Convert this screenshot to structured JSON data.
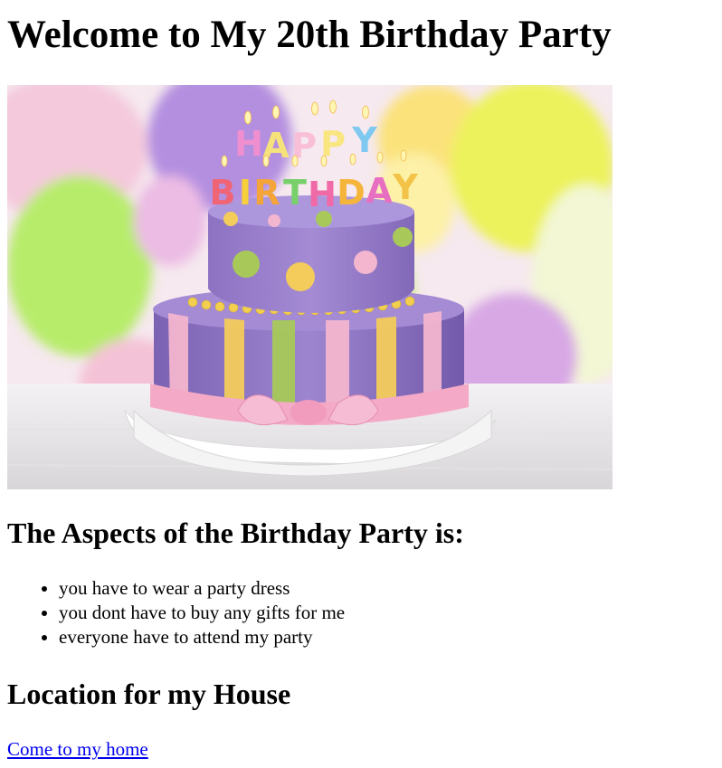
{
  "page": {
    "title": "Welcome to My 20th Birthday Party",
    "image_subject": "birthday-cake",
    "cake_letters_top": [
      "H",
      "A",
      "P",
      "P",
      "Y"
    ],
    "cake_letters_bottom": [
      "B",
      "I",
      "R",
      "T",
      "H",
      "D",
      "A",
      "Y"
    ],
    "aspects_heading": "The Aspects of the Birthday Party is:",
    "aspects": [
      "you have to wear a party dress",
      "you dont have to buy any gifts for me",
      "everyone have to attend my party"
    ],
    "location_heading": "Location for my House",
    "link_text": "Come to my home",
    "colors": {
      "link": "#0000ee",
      "cake_purple": "#9a7fce",
      "cake_pink": "#f4b6cf",
      "cake_yellow": "#f4cc5c",
      "cake_green": "#a8c95a"
    }
  }
}
